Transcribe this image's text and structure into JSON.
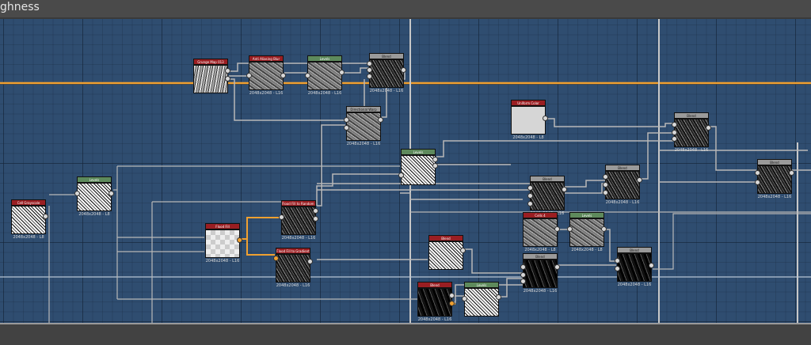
{
  "title": "ghness",
  "colors": {
    "accent_wire": "#f0a030",
    "wire": "#b8b8b8",
    "header_red": "#9a1e22",
    "header_green": "#5e8a5c",
    "header_grey": "#9a9a9a"
  },
  "nodes": [
    {
      "id": "n1",
      "label": "Grunge Map 013",
      "size": "",
      "header": "red"
    },
    {
      "id": "n2",
      "label": "Anti Aliasing Blur",
      "size": "2048x2048 - L16",
      "header": "red"
    },
    {
      "id": "n3",
      "label": "Levels",
      "size": "2048x2048 - L16",
      "header": "green"
    },
    {
      "id": "n4",
      "label": "Blend",
      "size": "2048x2048 - L16",
      "header": "grey"
    },
    {
      "id": "n5",
      "label": "Directional Warp",
      "size": "2048x2048 - L16",
      "header": "grey"
    },
    {
      "id": "n6",
      "label": "Uniform Color",
      "size": "2048x2048 - L8",
      "header": "red"
    },
    {
      "id": "n7",
      "label": "Levels",
      "size": "",
      "header": "green"
    },
    {
      "id": "n8",
      "label": "Blend",
      "size": "2048x2048 - L16",
      "header": "grey"
    },
    {
      "id": "n9",
      "label": "Blend",
      "size": "2048x2048 - L16",
      "header": "grey"
    },
    {
      "id": "n10",
      "label": "Blend",
      "size": "2048x2048 - L16",
      "header": "grey"
    },
    {
      "id": "n11",
      "label": "Blend",
      "size": "2048x2048 - L16",
      "header": "grey"
    },
    {
      "id": "n12",
      "label": "Cells 4",
      "size": "2048x2048 - L8",
      "header": "red"
    },
    {
      "id": "n13",
      "label": "Levels",
      "size": "2048x2048 - L8",
      "header": "green"
    },
    {
      "id": "n14",
      "label": "Flood Fill to Random Gr...",
      "size": "2048x2048 - L16",
      "header": "red"
    },
    {
      "id": "n15",
      "label": "Flood Fill",
      "size": "2048x2048 - L16",
      "header": "red"
    },
    {
      "id": "n16",
      "label": "Flood Fill to Gradient",
      "size": "2048x2048 - L16",
      "header": "red"
    },
    {
      "id": "n17",
      "label": "Blend",
      "size": "",
      "header": "red"
    },
    {
      "id": "n18",
      "label": "Blend",
      "size": "2048x2048 - L16",
      "header": "grey"
    },
    {
      "id": "n19",
      "label": "Blend",
      "size": "2048x2048 - L16",
      "header": "grey"
    },
    {
      "id": "n20",
      "label": "Blend",
      "size": "2048x2048 - L16",
      "header": "red"
    },
    {
      "id": "n21",
      "label": "Levels",
      "size": "",
      "header": "green"
    },
    {
      "id": "n22",
      "label": "Levels",
      "size": "2048x2048 - L8",
      "header": "green"
    },
    {
      "id": "n23",
      "label": "Cell Grayscale",
      "size": "2048x2048 - L8",
      "header": "red"
    }
  ]
}
